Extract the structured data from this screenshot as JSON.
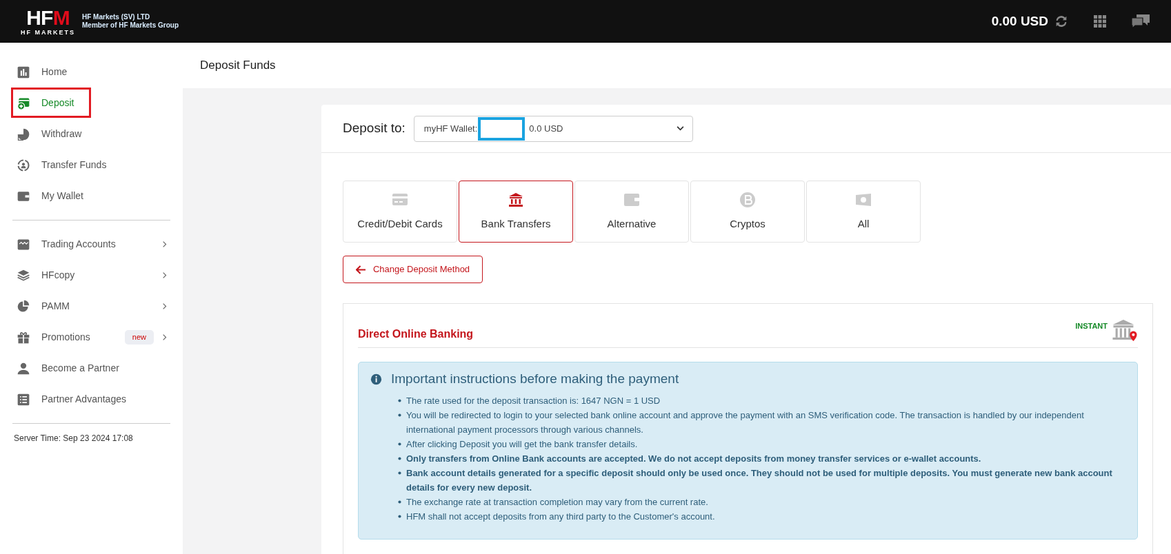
{
  "header": {
    "logo": {
      "mark_left": "HF",
      "mark_right": "M",
      "sub": "HF MARKETS"
    },
    "company": [
      "HF Markets (SV) LTD",
      "Member of HF Markets Group"
    ],
    "balance": "0.00 USD"
  },
  "sidebar": {
    "groups": [
      [
        {
          "label": "Home",
          "selected": false
        },
        {
          "label": "Deposit",
          "selected": true
        },
        {
          "label": "Withdraw",
          "selected": false
        },
        {
          "label": "Transfer Funds",
          "selected": false
        },
        {
          "label": "My Wallet",
          "selected": false
        }
      ],
      [
        {
          "label": "Trading Accounts",
          "selected": false,
          "expandable": true
        },
        {
          "label": "HFcopy",
          "selected": false,
          "expandable": true
        },
        {
          "label": "PAMM",
          "selected": false,
          "expandable": true
        },
        {
          "label": "Promotions",
          "selected": false,
          "expandable": true,
          "badge": "new"
        },
        {
          "label": "Become a Partner",
          "selected": false,
          "expandable": false
        },
        {
          "label": "Partner Advantages",
          "selected": false,
          "expandable": false
        }
      ]
    ],
    "server_time": "Server Time: Sep 23 2024 17:08"
  },
  "page_title": "Deposit Funds",
  "deposit_to": {
    "label": "Deposit to:",
    "wallet": "myHF Wallet:",
    "amount": "0.0 USD"
  },
  "methods": [
    {
      "label": "Credit/Debit Cards",
      "selected": false
    },
    {
      "label": "Bank Transfers",
      "selected": true
    },
    {
      "label": "Alternative",
      "selected": false
    },
    {
      "label": "Cryptos",
      "selected": false
    },
    {
      "label": "All",
      "selected": false
    }
  ],
  "change_button": "Change Deposit Method",
  "panel": {
    "title": "Direct Online Banking",
    "badge": "INSTANT",
    "notice": {
      "title": "Important instructions before making the payment",
      "items": [
        {
          "text": "The rate used for the deposit transaction is: 1647 NGN = 1 USD",
          "bold": false
        },
        {
          "text": "You will be redirected to login to your selected bank online account and approve the payment with an SMS verification code. The transaction is handled by our independent international payment processors through various channels.",
          "bold": false
        },
        {
          "text": "After clicking Deposit you will get the bank transfer details.",
          "bold": false
        },
        {
          "text": "Only transfers from Online Bank accounts are accepted. We do not accept deposits from money transfer services or e-wallet accounts.",
          "bold": true
        },
        {
          "text": "Bank account details generated for a specific deposit should only be used once. They should not be used for multiple deposits. You must generate new bank account details for every new deposit.",
          "bold": true
        },
        {
          "text": "The exchange rate at transaction completion may vary from the current rate.",
          "bold": false
        },
        {
          "text": "HFM shall not accept deposits from any third party to the Customer's account.",
          "bold": false
        }
      ]
    }
  }
}
